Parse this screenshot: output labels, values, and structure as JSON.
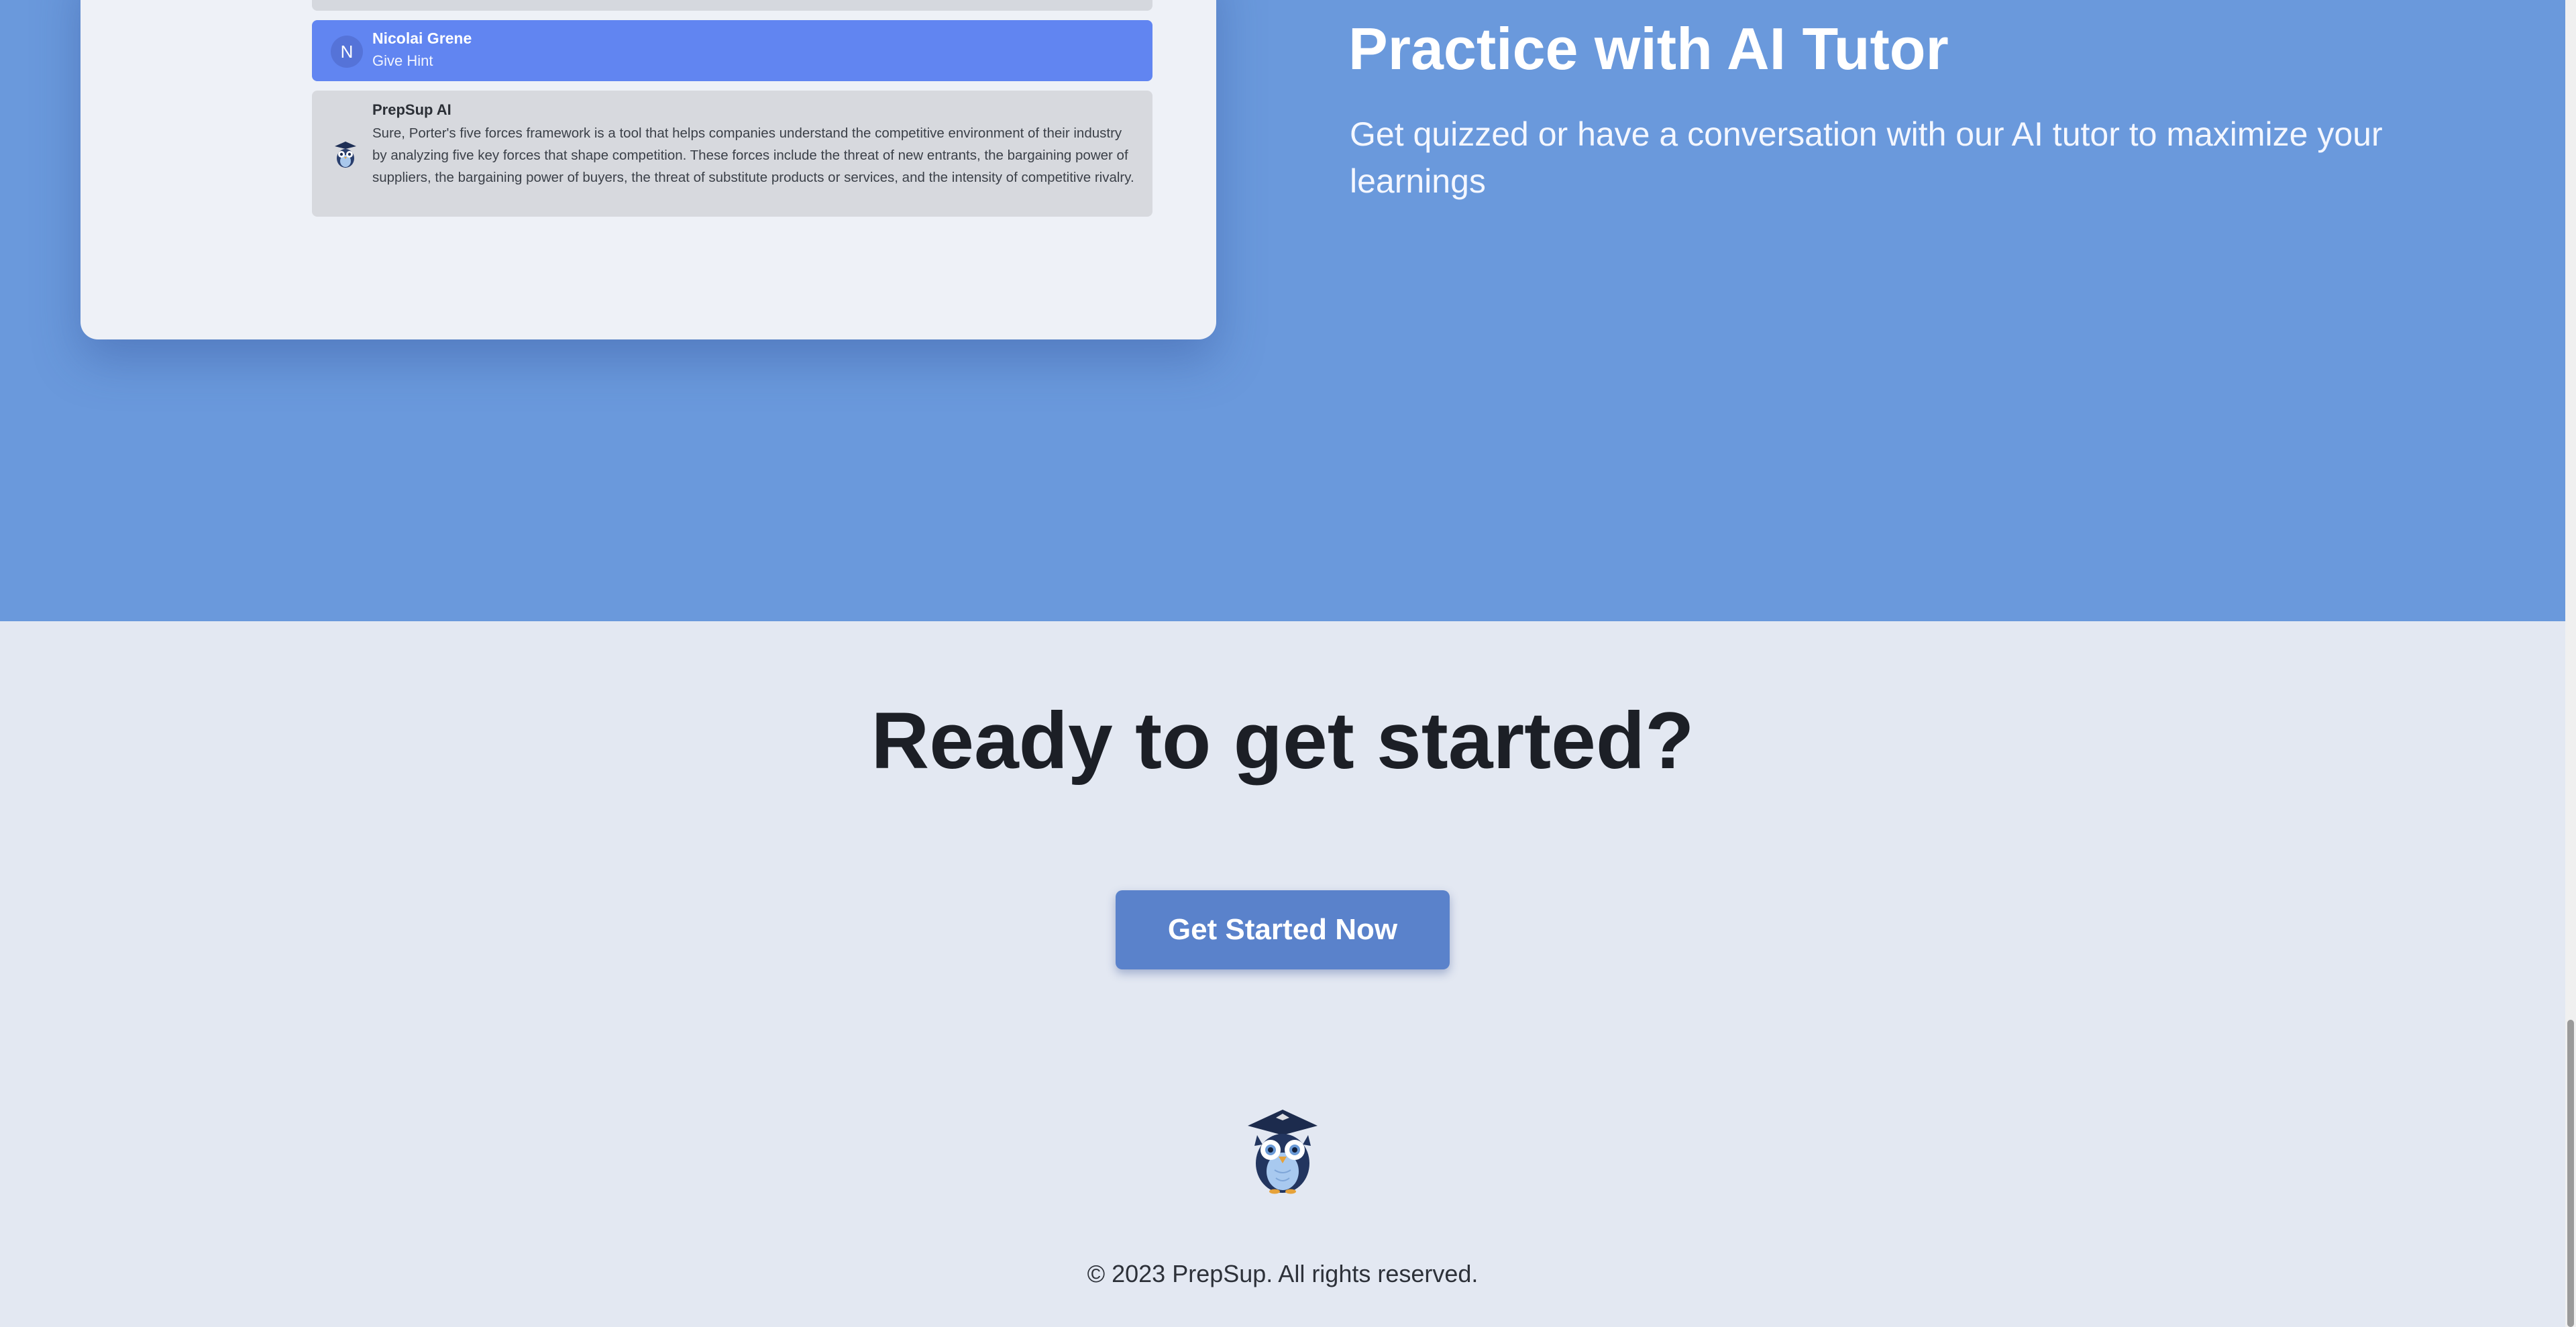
{
  "feature": {
    "title": "Practice with AI Tutor",
    "subtitle": "Get quizzed or have a conversation with our AI tutor to maximize your learnings",
    "chat": {
      "user_message": {
        "avatar_initial": "N",
        "name": "Nicolai Grene",
        "text": "Give Hint"
      },
      "ai_message": {
        "avatar_icon": "owl-mascot-icon",
        "name": "PrepSup AI",
        "text": "Sure, Porter's five forces framework is a tool that helps companies understand the competitive environment of their industry by analyzing five key forces that shape competition. These forces include the threat of new entrants, the bargaining power of suppliers, the bargaining power of buyers, the threat of substitute products or services, and the intensity of competitive rivalry."
      }
    }
  },
  "cta": {
    "title": "Ready to get started?",
    "button_label": "Get Started Now"
  },
  "footer": {
    "logo_icon": "owl-logo-icon",
    "copyright": "© 2023 PrepSup. All rights reserved."
  },
  "colors": {
    "feature_background": "#6a99dc",
    "page_background": "#e3e8f2",
    "user_message_background": "#6185f1",
    "ai_message_background": "#d7d9de",
    "button_background": "#5a82cb",
    "heading_text": "#1c1f26"
  }
}
